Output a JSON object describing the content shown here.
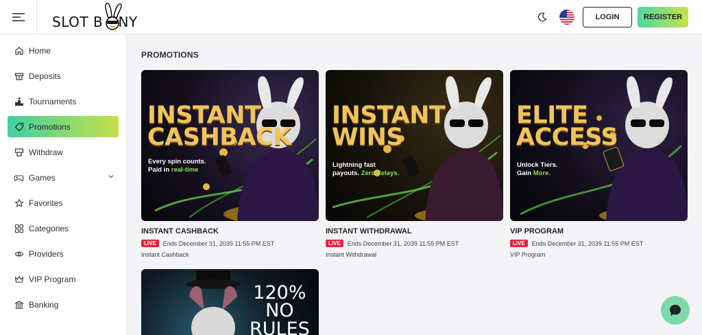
{
  "header": {
    "logo_text": "SLOT B NNY",
    "login_label": "LOGIN",
    "register_label": "REGISTER"
  },
  "sidebar": {
    "items": [
      {
        "label": "Home",
        "icon": "home-icon"
      },
      {
        "label": "Deposits",
        "icon": "deposit-icon"
      },
      {
        "label": "Tournaments",
        "icon": "podium-icon"
      },
      {
        "label": "Promotions",
        "icon": "tag-icon",
        "active": true
      },
      {
        "label": "Withdraw",
        "icon": "withdraw-icon"
      },
      {
        "label": "Games",
        "icon": "gamepad-icon"
      },
      {
        "label": "Favorites",
        "icon": "star-icon"
      },
      {
        "label": "Categories",
        "icon": "grid-icon"
      },
      {
        "label": "Providers",
        "icon": "providers-icon"
      },
      {
        "label": "VIP Program",
        "icon": "crown-icon"
      },
      {
        "label": "Banking",
        "icon": "bank-icon"
      }
    ]
  },
  "main": {
    "title": "PROMOTIONS",
    "cards": [
      {
        "headline": [
          "INSTANT",
          "CASHBACK"
        ],
        "tagline": [
          "Every spin counts.",
          "Paid in ",
          "real-time"
        ],
        "title": "INSTANT CASHBACK",
        "badge": "LIVE",
        "ends": "Ends December 31, 2039 11:55 PM EST",
        "subtitle": "Instant Cashback"
      },
      {
        "headline": [
          "INSTANT",
          "WINS"
        ],
        "tagline": [
          "Lightning fast",
          "payouts. ",
          "Zero delays."
        ],
        "title": "INSTANT WITHDRAWAL",
        "badge": "LIVE",
        "ends": "Ends December 31, 2039 11:55 PM EST",
        "subtitle": "Instant Withdrawal"
      },
      {
        "headline": [
          "ELITE",
          "ACCESS"
        ],
        "tagline": [
          "Unlock Tiers.",
          "Gain ",
          "More."
        ],
        "title": "VIP PROGRAM",
        "badge": "LIVE",
        "ends": "Ends December 31, 2039 11:55 PM EST",
        "subtitle": "VIP Program"
      }
    ],
    "partial_card": {
      "headline": [
        "120%",
        "NO",
        "RULES"
      ]
    }
  },
  "colors": {
    "accent_gradient_start": "#41d0a0",
    "accent_gradient_end": "#c6e04a",
    "live_badge": "#e0243b",
    "promo_gold": "#f0c45a",
    "promo_green": "#8ee24a"
  }
}
